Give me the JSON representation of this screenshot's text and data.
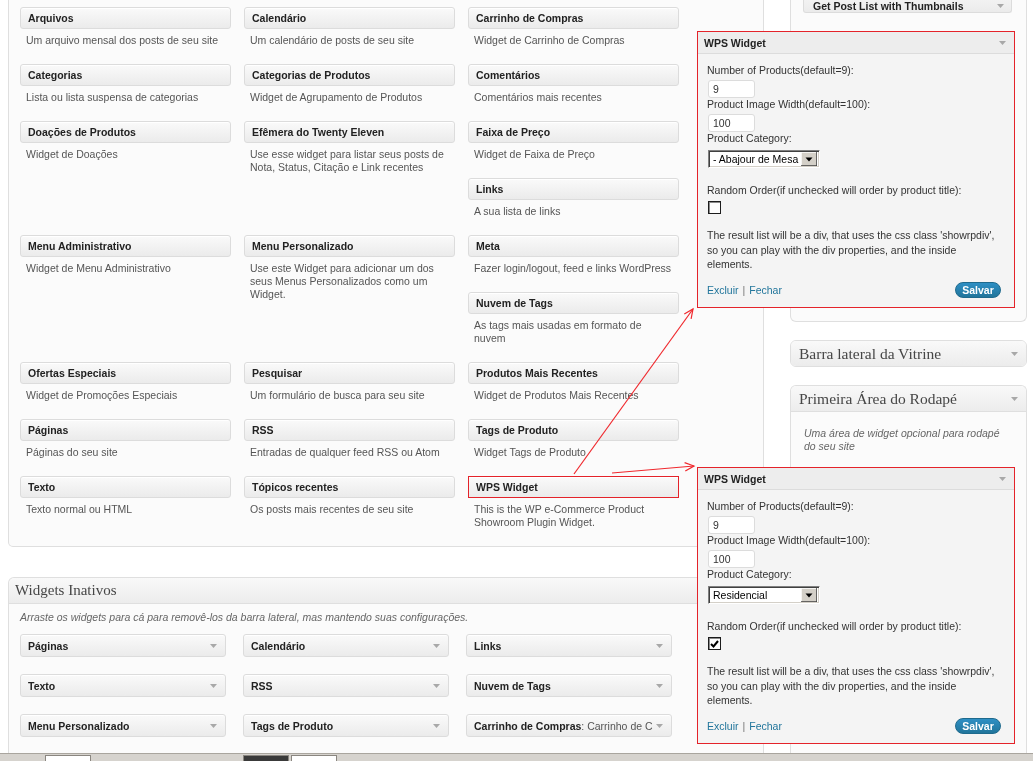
{
  "available_widgets": [
    {
      "title": "Arquivos",
      "description": "Um arquivo mensal dos posts de seu site",
      "highlighted": false
    },
    {
      "title": "Calendário",
      "description": "Um calendário de posts de seu site",
      "highlighted": false
    },
    {
      "title": "Carrinho de Compras",
      "description": "Widget de Carrinho de Compras",
      "highlighted": false
    },
    {
      "title": "Categorias",
      "description": "Lista ou lista suspensa de categorias",
      "highlighted": false
    },
    {
      "title": "Categorias de Produtos",
      "description": "Widget de Agrupamento de Produtos",
      "highlighted": false
    },
    {
      "title": "Comentários",
      "description": "Comentários mais recentes",
      "highlighted": false
    },
    {
      "title": "Doações de Produtos",
      "description": "Widget de Doações",
      "highlighted": false
    },
    {
      "title": "Efêmera do Twenty Eleven",
      "description": "Use esse widget para listar seus posts de Nota, Status, Citação e Link recentes",
      "highlighted": false
    },
    {
      "title": "Faixa de Preço",
      "description": "Widget de Faixa de Preço",
      "highlighted": false
    },
    {
      "title": "Links",
      "description": "A sua lista de links",
      "highlighted": false
    },
    {
      "title": "Menu Administrativo",
      "description": "Widget de Menu Administrativo",
      "highlighted": false
    },
    {
      "title": "Menu Personalizado",
      "description": "Use este Widget para adicionar um dos seus Menus Personalizados como um Widget.",
      "highlighted": false
    },
    {
      "title": "Meta",
      "description": "Fazer login/logout, feed e links WordPress",
      "highlighted": false
    },
    {
      "title": "Nuvem de Tags",
      "description": "As tags mais usadas em formato de nuvem",
      "highlighted": false
    },
    {
      "title": "Ofertas Especiais",
      "description": "Widget de Promoções Especiais",
      "highlighted": false
    },
    {
      "title": "Pesquisar",
      "description": "Um formulário de busca para seu site",
      "highlighted": false
    },
    {
      "title": "Produtos Mais Recentes",
      "description": "Widget de Produtos Mais Recentes",
      "highlighted": false
    },
    {
      "title": "Páginas",
      "description": "Páginas do seu site",
      "highlighted": false
    },
    {
      "title": "RSS",
      "description": "Entradas de qualquer feed RSS ou Atom",
      "highlighted": false
    },
    {
      "title": "Tags de Produto",
      "description": "Widget Tags de Produto",
      "highlighted": false
    },
    {
      "title": "Texto",
      "description": "Texto normal ou HTML",
      "highlighted": false
    },
    {
      "title": "Tópicos recentes",
      "description": "Os posts mais recentes de seu site",
      "highlighted": false
    },
    {
      "title": "WPS Widget",
      "description": "This is the WP e-Commerce Product Showroom Plugin Widget.",
      "highlighted": true
    }
  ],
  "inactive_widgets": {
    "title": "Widgets Inativos",
    "description": "Arraste os widgets para cá para removê-los da barra lateral, mas mantendo suas configurações.",
    "items": [
      {
        "title": "Páginas"
      },
      {
        "title": "Calendário"
      },
      {
        "title": "Links"
      },
      {
        "title": "Texto"
      },
      {
        "title": "RSS"
      },
      {
        "title": "Nuvem de Tags"
      },
      {
        "title": "Menu Personalizado"
      },
      {
        "title": "Tags de Produto"
      },
      {
        "title": "Carrinho de Compras",
        "instance_title": ": Carrinho de C"
      }
    ]
  },
  "sidebar_top": {
    "widgets": [
      {
        "title": "Get Post List with Thumbnails"
      }
    ]
  },
  "sidebars": [
    {
      "title": "Barra lateral da Vitrine",
      "expanded": false
    },
    {
      "title": "Primeira Área do Rodapé",
      "expanded": true,
      "description": "Uma área de widget opcional para rodapé do seu site"
    }
  ],
  "widget_forms": [
    {
      "title": "WPS Widget",
      "fields": [
        {
          "kind": "text",
          "label": "Number of Products(default=9):",
          "value": "9"
        },
        {
          "kind": "text",
          "label": "Product Image Width(default=100):",
          "value": "100"
        },
        {
          "kind": "select",
          "label": "Product Category:",
          "value": "- Abajour de Mesa"
        },
        {
          "kind": "checkbox",
          "label": "Random Order(if unchecked will order by product title):",
          "checked": false
        }
      ],
      "note": "The result list will be a div, that uses the css class 'showrpdiv', so you can play with the div properties, and the inside elements.",
      "links": [
        "Excluir",
        "Fechar"
      ],
      "separator": "|",
      "save_button": "Salvar"
    },
    {
      "title": "WPS Widget",
      "fields": [
        {
          "kind": "text",
          "label": "Number of Products(default=9):",
          "value": "9"
        },
        {
          "kind": "text",
          "label": "Product Image Width(default=100):",
          "value": "100"
        },
        {
          "kind": "select",
          "label": "Product Category:",
          "value": "Residencial"
        },
        {
          "kind": "checkbox",
          "label": "Random Order(if unchecked will order by product title):",
          "checked": true
        }
      ],
      "note": "The result list will be a div, that uses the css class 'showrpdiv', so you can play with the div properties, and the inside elements.",
      "links": [
        "Excluir",
        "Fechar"
      ],
      "separator": "|",
      "save_button": "Salvar"
    }
  ]
}
